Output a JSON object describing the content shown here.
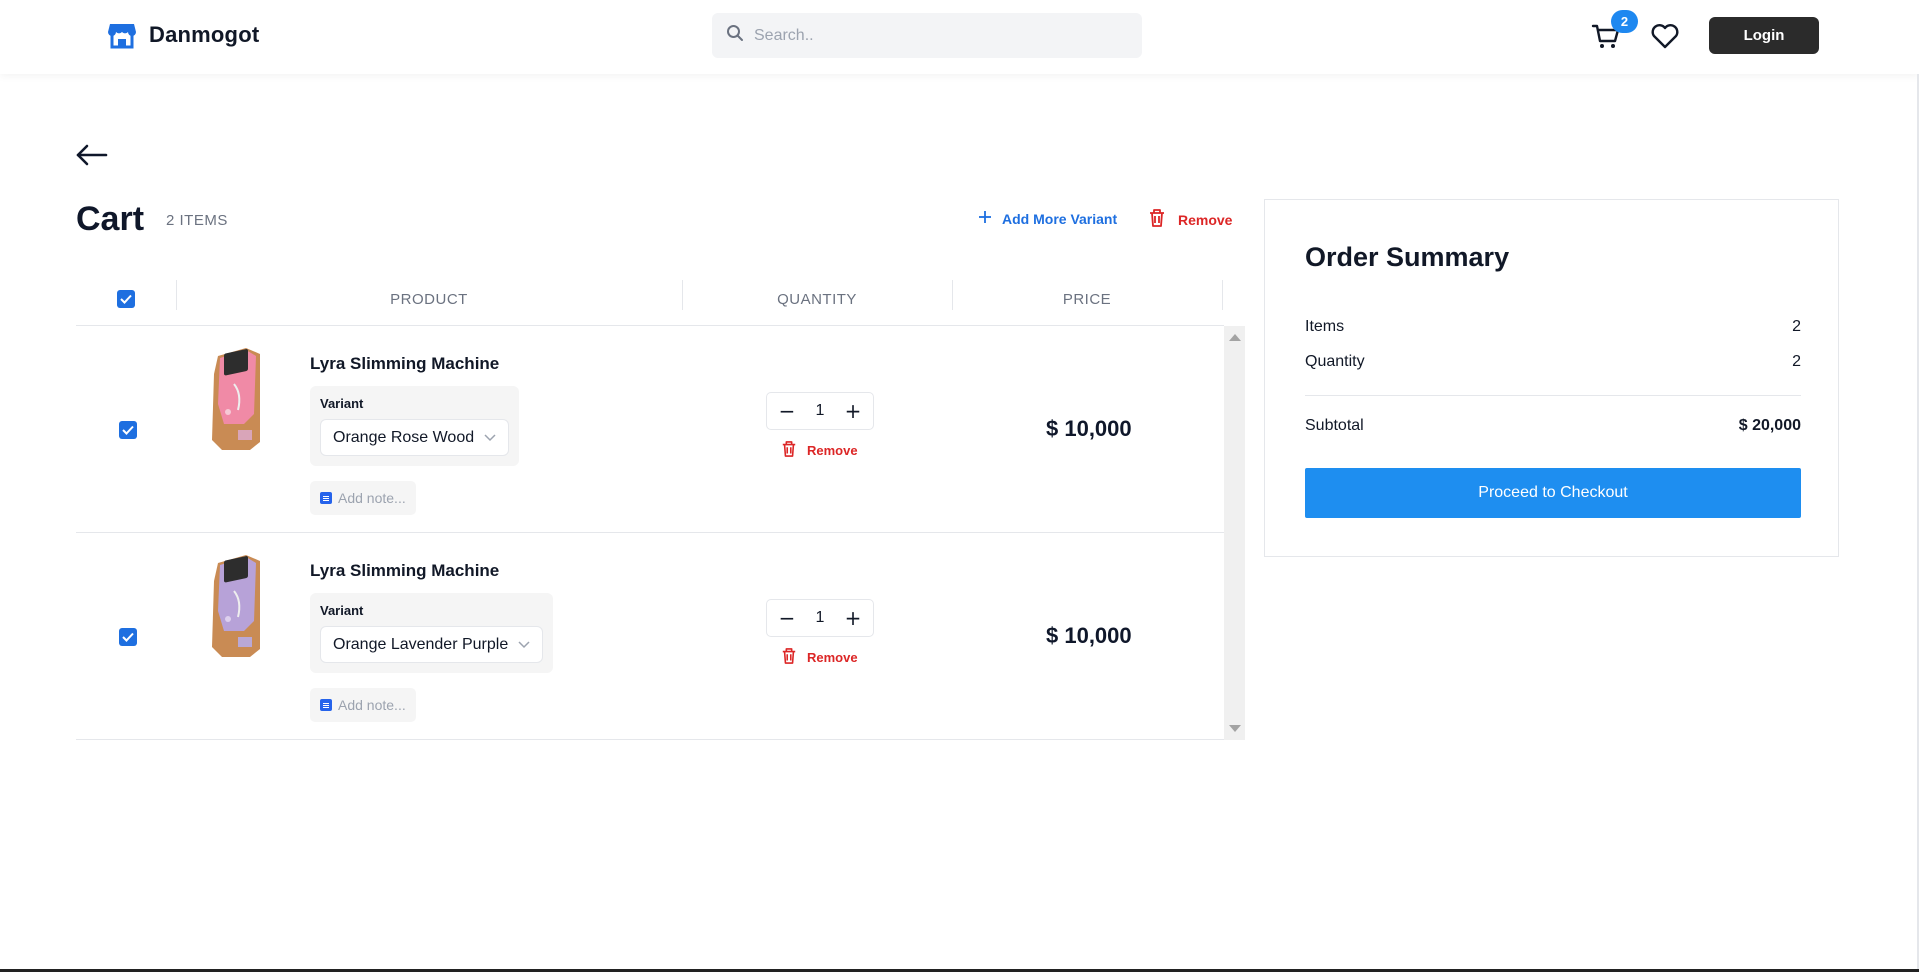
{
  "header": {
    "brand": "Danmogot",
    "search_placeholder": "Search..",
    "cart_badge": "2",
    "login_label": "Login",
    "icons": [
      "store-icon",
      "search-icon",
      "cart-icon",
      "heart-icon"
    ]
  },
  "cart": {
    "title": "Cart",
    "count_label": "2 ITEMS",
    "add_variant_label": "Add More Variant",
    "remove_label": "Remove",
    "columns": [
      "PRODUCT",
      "QUANTITY",
      "PRICE"
    ],
    "items": [
      {
        "name": "Lyra Slimming Machine",
        "variant_label": "Variant",
        "variant_value": "Orange Rose Wood",
        "note_placeholder": "Add note...",
        "quantity": "1",
        "remove_label": "Remove",
        "price": "$ 10,000",
        "image_color": "#f08aa6"
      },
      {
        "name": "Lyra Slimming Machine",
        "variant_label": "Variant",
        "variant_value": "Orange Lavender Purple",
        "note_placeholder": "Add note...",
        "quantity": "1",
        "remove_label": "Remove",
        "price": "$ 10,000",
        "image_color": "#b7a2d8"
      }
    ]
  },
  "summary": {
    "title": "Order Summary",
    "items_label": "Items",
    "items_value": "2",
    "quantity_label": "Quantity",
    "quantity_value": "2",
    "subtotal_label": "Subtotal",
    "subtotal_value": "$ 20,000",
    "checkout_label": "Proceed to Checkout"
  },
  "colors": {
    "accent": "#1e8ef0",
    "danger": "#dc2626",
    "dark": "#2b2b2b"
  }
}
